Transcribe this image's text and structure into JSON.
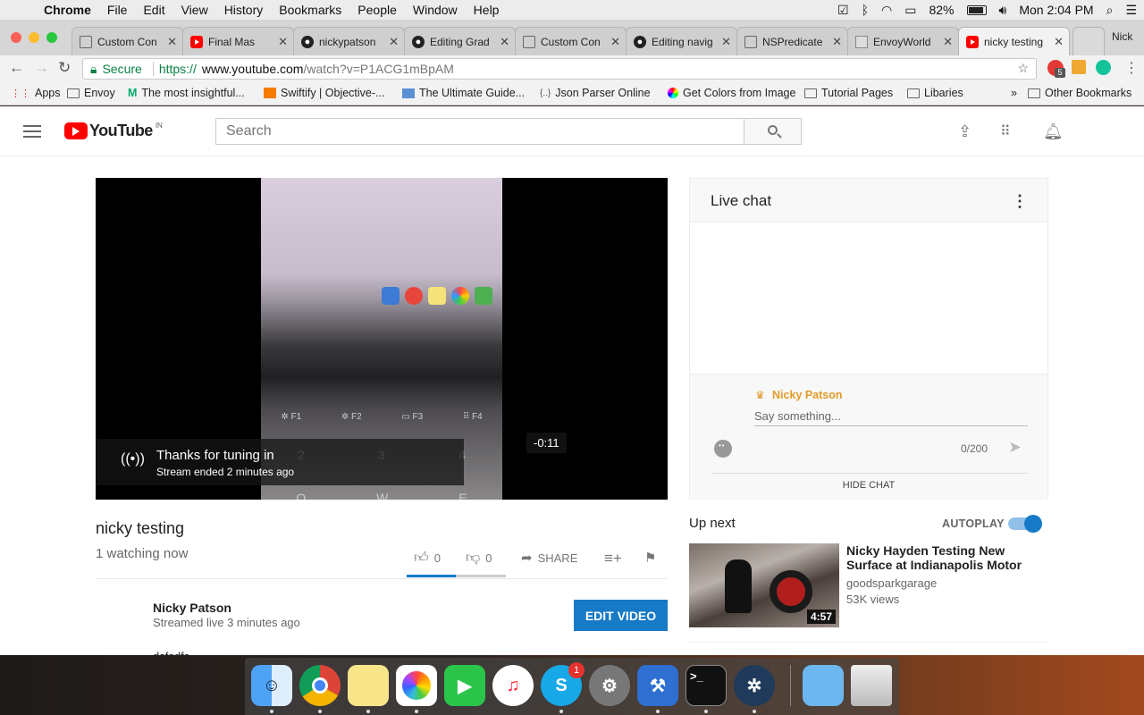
{
  "menubar": {
    "app": "Chrome",
    "items": [
      "File",
      "Edit",
      "View",
      "History",
      "Bookmarks",
      "People",
      "Window",
      "Help"
    ],
    "battery": "82%",
    "clock": "Mon 2:04 PM"
  },
  "browser": {
    "profile": "Nick",
    "tabs": [
      {
        "title": "Custom Con",
        "icon": "document-icon"
      },
      {
        "title": "Final Mas",
        "icon": "youtube-icon"
      },
      {
        "title": "nickypatson",
        "icon": "github-icon"
      },
      {
        "title": "Editing Grad",
        "icon": "github-icon"
      },
      {
        "title": "Custom Con",
        "icon": "document-icon"
      },
      {
        "title": "Editing navig",
        "icon": "github-icon"
      },
      {
        "title": "NSPredicate",
        "icon": "document-icon"
      },
      {
        "title": "EnvoyWorld",
        "icon": "envoy-icon"
      },
      {
        "title": "nicky testing",
        "icon": "youtube-icon",
        "active": true
      }
    ],
    "secure_label": "Secure",
    "url_scheme": "https://",
    "url_host": "www.youtube.com",
    "url_rest": "/watch?v=P1ACG1mBpAM",
    "extension_badge": "5",
    "bookmarks": [
      "Apps",
      "Envoy",
      "The most insightful...",
      "Swiftify | Objective-...",
      "The Ultimate Guide...",
      "Json Parser Online",
      "Get Colors from Image",
      "Tutorial Pages",
      "Libaries",
      "Other Bookmarks"
    ]
  },
  "youtube": {
    "logo_text": "YouTube",
    "country": "IN",
    "search_placeholder": "Search",
    "player": {
      "overlay_title": "Thanks for tuning in",
      "overlay_subtitle": "Stream ended 2 minutes ago",
      "time": "-0:11"
    },
    "video": {
      "title": "nicky testing",
      "watching": "1 watching now",
      "likes": "0",
      "dislikes": "0",
      "share": "SHARE",
      "channel": "Nicky Patson",
      "streamed": "Streamed live 3 minutes ago",
      "edit_button": "EDIT VIDEO",
      "description": "dsfsdfs"
    },
    "chat": {
      "title": "Live chat",
      "user": "Nicky Patson",
      "input_placeholder": "Say something...",
      "counter": "0/200",
      "hide": "HIDE CHAT"
    },
    "up_next": {
      "label": "Up next",
      "autoplay": "AUTOPLAY",
      "autoplay_on": true,
      "item": {
        "title": "Nicky Hayden Testing New Surface at Indianapolis Motor",
        "channel": "goodsparkgarage",
        "views": "53K views",
        "duration": "4:57"
      }
    }
  },
  "dock": {
    "apps": [
      "finder",
      "chrome",
      "notes",
      "photos",
      "facetime",
      "itunes",
      "skype",
      "system-preferences",
      "xcode",
      "terminal",
      "sourcetree",
      "downloads",
      "trash"
    ],
    "skype_badge": "1"
  },
  "colors": {
    "youtube_red": "#ff0000",
    "youtube_blue": "#167ac6",
    "chat_owner": "#e39a2a"
  }
}
